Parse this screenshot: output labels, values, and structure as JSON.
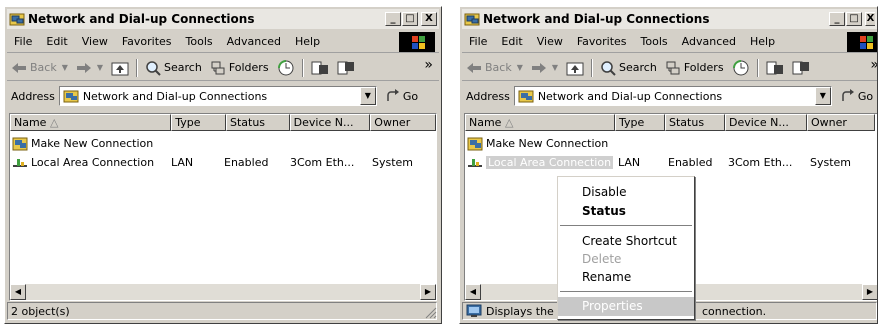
{
  "window": {
    "title": "Network and Dial-up Connections",
    "minimize": "_",
    "maximize": "□",
    "close": "X"
  },
  "menu": [
    "File",
    "Edit",
    "View",
    "Favorites",
    "Tools",
    "Advanced",
    "Help"
  ],
  "toolbar": {
    "back": "Back",
    "search": "Search",
    "folders": "Folders",
    "more": "»"
  },
  "address": {
    "label": "Address",
    "value": "Network and Dial-up Connections",
    "go": "Go"
  },
  "columns": [
    "Name",
    "Type",
    "Status",
    "Device N...",
    "Owner"
  ],
  "items": [
    {
      "name": "Make New Connection",
      "type": "",
      "status": "",
      "device": "",
      "owner": ""
    },
    {
      "name": "Local Area Connection",
      "type": "LAN",
      "status": "Enabled",
      "device": "3Com Eth...",
      "owner": "System"
    }
  ],
  "status_left": "2 object(s)",
  "status_right_prefix": "Displays the p",
  "status_right_suffix": "connection.",
  "context_menu": {
    "items": [
      "Disable",
      "Status",
      "Create Shortcut",
      "Delete",
      "Rename",
      "Properties"
    ]
  },
  "colors": {
    "titlebar": "#e9e7e2",
    "face": "#d4d0c8",
    "selection": "#cfcfcf"
  },
  "icons": {
    "window": "network-folder-icon",
    "back": "back-arrow-icon",
    "forward": "forward-arrow-icon",
    "up": "up-folder-icon",
    "search": "search-icon",
    "folders": "folders-icon",
    "history": "history-icon",
    "move": "move-to-icon",
    "copy": "copy-to-icon",
    "go": "go-arrow-icon"
  }
}
